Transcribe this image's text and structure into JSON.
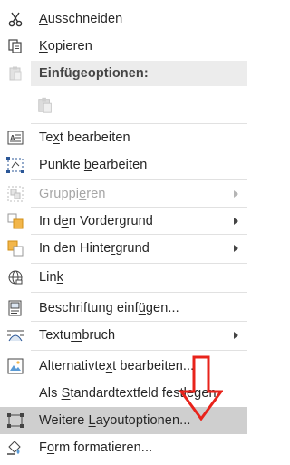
{
  "menu": {
    "cut": {
      "label_u": "A",
      "label_rest": "usschneiden",
      "icon": "scissors-icon"
    },
    "copy": {
      "label_u": "K",
      "label_rest": "opieren",
      "icon": "copy-icon"
    },
    "paste_header": {
      "label": "Einfügeoptionen:"
    },
    "paste_option": {
      "icon": "clipboard-icon"
    },
    "edit_text": {
      "label_pre": "Te",
      "label_u": "x",
      "label_post": "t bearbeiten",
      "icon": "text-box-icon"
    },
    "edit_points": {
      "label_pre": "Punkte ",
      "label_u": "b",
      "label_post": "earbeiten",
      "icon": "edit-points-icon"
    },
    "group": {
      "label_pre": "Gruppi",
      "label_u": "e",
      "label_post": "ren",
      "icon": "group-icon",
      "enabled": false
    },
    "bring_front": {
      "label_pre": "In d",
      "label_u": "e",
      "label_post": "n Vordergrund",
      "icon": "bring-to-front-icon"
    },
    "send_back": {
      "label_pre": "In den Hinte",
      "label_u": "r",
      "label_post": "grund",
      "icon": "send-to-back-icon"
    },
    "link": {
      "label_pre": "Lin",
      "label_u": "k",
      "label_post": "",
      "icon": "link-icon"
    },
    "caption": {
      "label_pre": "Beschriftung einf",
      "label_u": "ü",
      "label_post": "gen...",
      "icon": "caption-icon"
    },
    "wrap": {
      "label_pre": "Textu",
      "label_u": "m",
      "label_post": "bruch",
      "icon": "text-wrap-icon"
    },
    "alt_text": {
      "label_pre": "Alternativte",
      "label_u": "x",
      "label_post": "t bearbeiten...",
      "icon": "alt-text-icon"
    },
    "default_textbox": {
      "label_pre": "Als ",
      "label_u": "S",
      "label_post": "tandardtextfeld festlegen"
    },
    "layout_options": {
      "label_pre": "Weitere ",
      "label_u": "L",
      "label_post": "ayoutoptionen...",
      "icon": "layout-options-icon"
    },
    "format_shape": {
      "label_pre": "F",
      "label_u": "o",
      "label_post": "rm formatieren...",
      "icon": "format-shape-icon"
    }
  },
  "colors": {
    "highlight": "#cfcfcf",
    "annotation_arrow": "#e8231b"
  }
}
